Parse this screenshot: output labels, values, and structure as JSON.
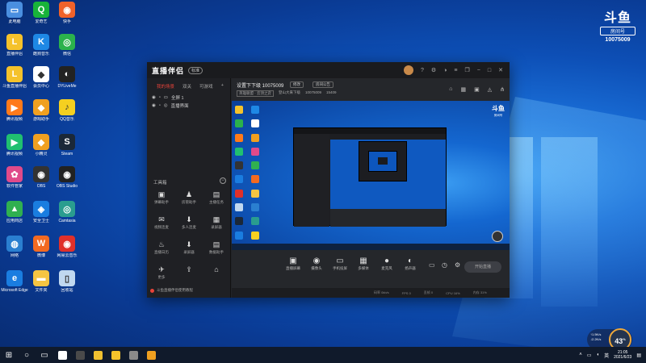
{
  "desktop": {
    "icons": [
      {
        "label": "此电脑",
        "color": "#4a8fe0",
        "glyph": "▭"
      },
      {
        "label": "爱奇艺",
        "color": "#18b33a",
        "glyph": "Q"
      },
      {
        "label": "快手",
        "color": "#f0622a",
        "glyph": "◉"
      },
      {
        "label": "直播伴侣",
        "color": "#f5c22b",
        "glyph": "L"
      },
      {
        "label": "酷狗音乐",
        "color": "#1e88e5",
        "glyph": "K"
      },
      {
        "label": "微信",
        "color": "#2bb24c",
        "glyph": "◎"
      },
      {
        "label": "斗鱼直播伴侣",
        "color": "#f5c22b",
        "glyph": "L"
      },
      {
        "label": "会员中心",
        "color": "#ffffff",
        "glyph": "◆"
      },
      {
        "label": "DYLiveMe",
        "color": "#222222",
        "glyph": "◐"
      },
      {
        "label": "腾讯视频",
        "color": "#ff7a1a",
        "glyph": "▶"
      },
      {
        "label": "游戏助手",
        "color": "#f0a020",
        "glyph": "◆"
      },
      {
        "label": "QQ音乐",
        "color": "#f5d020",
        "glyph": "♪"
      },
      {
        "label": "腾讯视频",
        "color": "#20c070",
        "glyph": "▶"
      },
      {
        "label": "小精灵",
        "color": "#f0a020",
        "glyph": "◆"
      },
      {
        "label": "Steam",
        "color": "#1b2838",
        "glyph": "S"
      },
      {
        "label": "软件管家",
        "color": "#e04a8a",
        "glyph": "✿"
      },
      {
        "label": "OBS",
        "color": "#333333",
        "glyph": "◉"
      },
      {
        "label": "OBS Studio",
        "color": "#222222",
        "glyph": "◉"
      },
      {
        "label": "应用商店",
        "color": "#30b050",
        "glyph": "▲"
      },
      {
        "label": "安全卫士",
        "color": "#1a7de0",
        "glyph": "◈"
      },
      {
        "label": "Camtasia",
        "color": "#2a9d8f",
        "glyph": "◎"
      },
      {
        "label": "网络",
        "color": "#2a7fd0",
        "glyph": "◍"
      },
      {
        "label": "微博",
        "color": "#f26a21",
        "glyph": "W"
      },
      {
        "label": "网易云音乐",
        "color": "#e0302a",
        "glyph": "◉"
      },
      {
        "label": "Microsoft Edge",
        "color": "#1a7de0",
        "glyph": "e"
      },
      {
        "label": "文件夹",
        "color": "#f5c542",
        "glyph": "▬"
      },
      {
        "label": "回收站",
        "color": "#c0d8f0",
        "glyph": "▯"
      }
    ]
  },
  "douyu": {
    "logo": "斗鱼",
    "room_label": "房间号",
    "room_number": "10075009"
  },
  "app": {
    "brand": "直播伴侣",
    "tag": "标准",
    "left_tabs": [
      "我的场景",
      "双关",
      "可游戏"
    ],
    "plus": "+",
    "scenes": [
      "全屏 1",
      "直播界面"
    ],
    "tools_header": "工具箱",
    "tools": [
      {
        "icon": "▣",
        "label": "弹幕助手"
      },
      {
        "icon": "♟",
        "label": "房管助手"
      },
      {
        "icon": "▤",
        "label": "主播任务"
      },
      {
        "icon": "✉",
        "label": "视频连麦"
      },
      {
        "icon": "⬇",
        "label": "多人连麦"
      },
      {
        "icon": "▦",
        "label": "录屏器"
      },
      {
        "icon": "♨",
        "label": "直播日历"
      },
      {
        "icon": "⬇",
        "label": "录屏器"
      },
      {
        "icon": "▤",
        "label": "数据助手"
      },
      {
        "icon": "✈",
        "label": "更多"
      },
      {
        "icon": "⇪",
        "label": ""
      },
      {
        "icon": "⌂",
        "label": ""
      }
    ],
    "tip": "斗鱼直播伴侣使用教程",
    "room_title": "设置下下级 10075009",
    "edit_btn": "修改",
    "notice_btn": "房间公告",
    "info": {
      "category": "英雄联盟 · 云顶之弈",
      "owner": "登山大来下级",
      "room_id": "10075009",
      "popularity": "15409"
    },
    "controls": [
      {
        "icon": "▣",
        "label": "直播屏幕"
      },
      {
        "icon": "◉",
        "label": "摄像头"
      },
      {
        "icon": "▭",
        "label": "手机投屏"
      },
      {
        "icon": "▦",
        "label": "多媒体"
      },
      {
        "icon": "●",
        "label": "麦克风"
      },
      {
        "icon": "◐",
        "label": "扬声器"
      }
    ],
    "go_live": "开始直播",
    "status": [
      "码率 0kb/s",
      "FPS 0",
      "丢帧 0",
      "CPU 16%",
      "内存 31%"
    ]
  },
  "overlay": {
    "value": "43",
    "unit": "%",
    "up": "↑1.5K/s",
    "down": "↓2.2K/s"
  },
  "taskbar": {
    "clock_time": "21:05",
    "clock_date": "2021/6/23",
    "apps": [
      {
        "color": "#ffffff"
      },
      {
        "color": "#4a4a4a"
      },
      {
        "color": "#f0c030"
      },
      {
        "color": "#f5c22b"
      },
      {
        "color": "#8a8a8a"
      },
      {
        "color": "#f0a020"
      }
    ]
  }
}
